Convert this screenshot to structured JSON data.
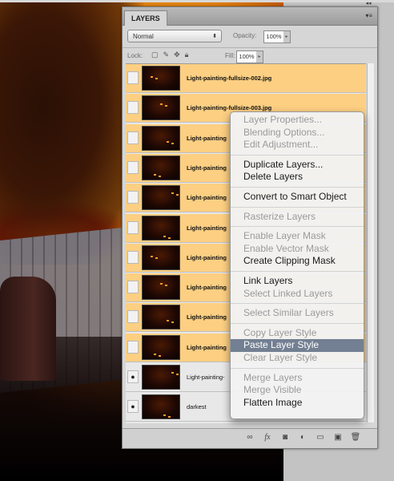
{
  "panel": {
    "tab_title": "LAYERS",
    "blend_mode": "Normal",
    "opacity_label": "Opacity:",
    "opacity_value": "100%",
    "lock_label": "Lock:",
    "fill_label": "Fill:",
    "fill_value": "100%"
  },
  "layers": [
    {
      "name": "Light-painting-fullsize-002.jpg",
      "selected": true,
      "visible": false
    },
    {
      "name": "Light-painting-fullsize-003.jpg",
      "selected": true,
      "visible": false
    },
    {
      "name": "Light-painting",
      "selected": true,
      "visible": false
    },
    {
      "name": "Light-painting",
      "selected": true,
      "visible": false
    },
    {
      "name": "Light-painting",
      "selected": true,
      "visible": false
    },
    {
      "name": "Light-painting",
      "selected": true,
      "visible": false
    },
    {
      "name": "Light-painting",
      "selected": true,
      "visible": false
    },
    {
      "name": "Light-painting",
      "selected": true,
      "visible": false
    },
    {
      "name": "Light-painting",
      "selected": true,
      "visible": false
    },
    {
      "name": "Light-painting",
      "selected": true,
      "visible": false
    },
    {
      "name": "Light-painting-",
      "selected": false,
      "visible": true
    },
    {
      "name": "darkest",
      "selected": false,
      "visible": true
    }
  ],
  "context_menu": [
    {
      "label": "Layer Properties...",
      "enabled": false
    },
    {
      "label": "Blending Options...",
      "enabled": false
    },
    {
      "label": "Edit Adjustment...",
      "enabled": false
    },
    {
      "sep": true
    },
    {
      "label": "Duplicate Layers...",
      "enabled": true
    },
    {
      "label": "Delete Layers",
      "enabled": true
    },
    {
      "sep": true
    },
    {
      "label": "Convert to Smart Object",
      "enabled": true
    },
    {
      "sep": true
    },
    {
      "label": "Rasterize Layers",
      "enabled": false
    },
    {
      "sep": true
    },
    {
      "label": "Enable Layer Mask",
      "enabled": false
    },
    {
      "label": "Enable Vector Mask",
      "enabled": false
    },
    {
      "label": "Create Clipping Mask",
      "enabled": true
    },
    {
      "sep": true
    },
    {
      "label": "Link Layers",
      "enabled": true
    },
    {
      "label": "Select Linked Layers",
      "enabled": false
    },
    {
      "sep": true
    },
    {
      "label": "Select Similar Layers",
      "enabled": false
    },
    {
      "sep": true
    },
    {
      "label": "Copy Layer Style",
      "enabled": false
    },
    {
      "label": "Paste Layer Style",
      "enabled": true,
      "highlighted": true
    },
    {
      "label": "Clear Layer Style",
      "enabled": false
    },
    {
      "sep": true
    },
    {
      "label": "Merge Layers",
      "enabled": false
    },
    {
      "label": "Merge Visible",
      "enabled": false
    },
    {
      "label": "Flatten Image",
      "enabled": true
    }
  ],
  "colors": {
    "selected_layer": "#fccf82",
    "menu_highlight": "#737f92"
  },
  "icons": {
    "bottom_tools": [
      "link-icon",
      "fx-icon",
      "mask-icon",
      "adjustment-icon",
      "group-icon",
      "new-layer-icon",
      "trash-icon"
    ]
  }
}
